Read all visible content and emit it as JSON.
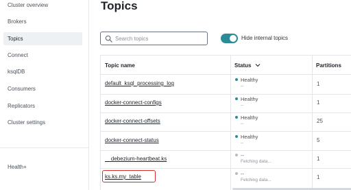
{
  "sidebar": {
    "items": [
      {
        "label": "Cluster overview",
        "active": false
      },
      {
        "label": "Brokers",
        "active": false
      },
      {
        "label": "Topics",
        "active": true
      },
      {
        "label": "Connect",
        "active": false
      },
      {
        "label": "ksqlDB",
        "active": false
      },
      {
        "label": "Consumers",
        "active": false
      },
      {
        "label": "Replicators",
        "active": false
      },
      {
        "label": "Cluster settings",
        "active": false
      }
    ],
    "footer_item": "Health+"
  },
  "main": {
    "title": "Topics",
    "search": {
      "placeholder": "Search topics",
      "value": ""
    },
    "hide_internal": {
      "label": "Hide internal topics",
      "enabled": true
    },
    "table": {
      "columns": {
        "name": "Topic name",
        "status": "Status",
        "partitions": "Partitions"
      },
      "rows": [
        {
          "name": "default_ksql_processing_log",
          "status": "Healthy",
          "sub": "--",
          "partitions": "1",
          "status_color": "#2b8c97"
        },
        {
          "name": "docker-connect-configs",
          "status": "Healthy",
          "sub": "--",
          "partitions": "1",
          "status_color": "#2b8c97"
        },
        {
          "name": "docker-connect-offsets",
          "status": "Healthy",
          "sub": "--",
          "partitions": "25",
          "status_color": "#2b8c97"
        },
        {
          "name": "docker-connect-status",
          "status": "Healthy",
          "sub": "--",
          "partitions": "5",
          "status_color": "#2b8c97"
        },
        {
          "name": "__debezium-heartbeat.ks",
          "status": "--",
          "sub": "Fetching data...",
          "partitions": "1",
          "status_color": "#b7bcc2"
        },
        {
          "name": "ks.ks.my_table",
          "status": "--",
          "sub": "Fetching data...",
          "partitions": "1",
          "status_color": "#b7bcc2"
        }
      ]
    }
  },
  "colors": {
    "accent": "#2b8c97",
    "highlight": "#d62b2b"
  }
}
